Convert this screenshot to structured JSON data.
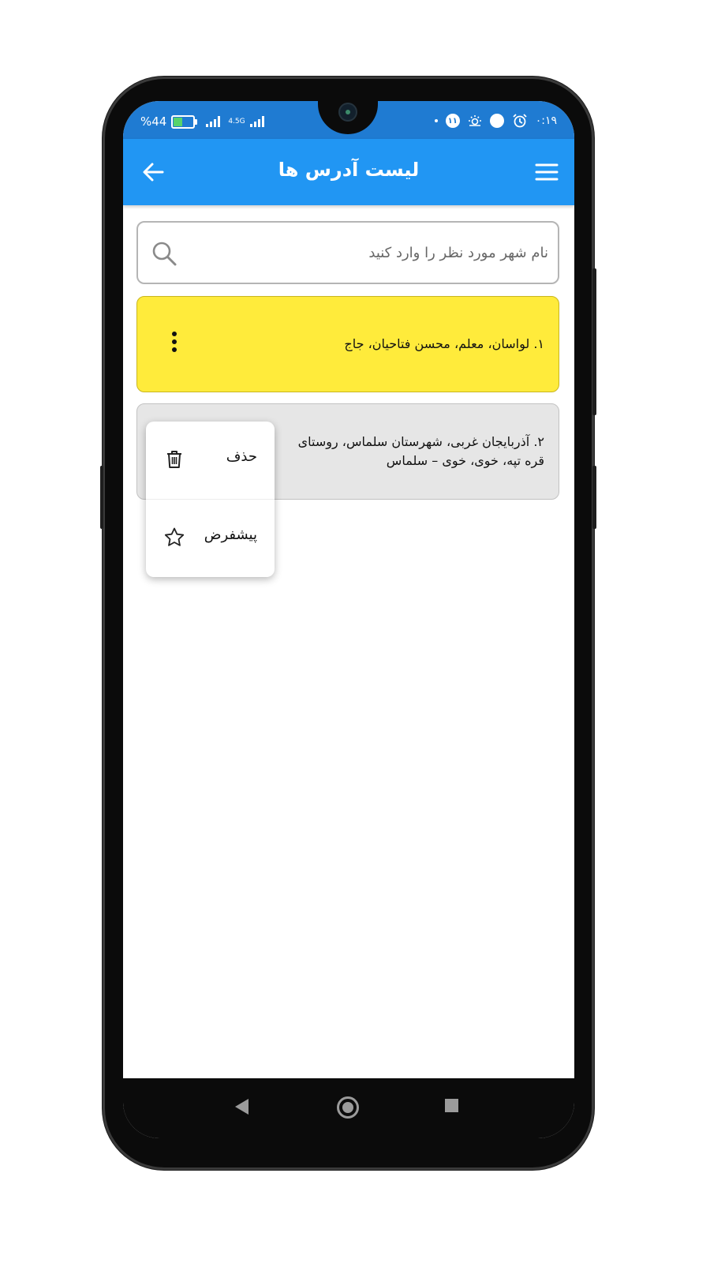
{
  "status_bar": {
    "battery_text": "%44",
    "network_type": "4.5G",
    "notification_count": "۱۱",
    "time": "۰:۱۹"
  },
  "app_bar": {
    "title": "لیست آدرس ها",
    "back_icon": "arrow-left-icon",
    "menu_icon": "hamburger-menu-icon"
  },
  "search": {
    "placeholder": "نام شهر مورد نظر را وارد کنید",
    "value": "",
    "icon": "search-icon"
  },
  "addresses": [
    {
      "number": "۱.",
      "text": "لواسان، معلم، محسن فتاحیان، جاج",
      "highlight_color": "#ffeb3b",
      "is_default": true
    },
    {
      "number": "۲.",
      "text": "آذربایجان غربی، شهرستان سلماس، روستای قره تپه، خوی، خوی – سلماس",
      "highlight_color": "#e6e6e6",
      "is_default": false
    }
  ],
  "context_menu": {
    "items": [
      {
        "label": "حذف",
        "icon": "trash-icon"
      },
      {
        "label": "پیشفرض",
        "icon": "star-outline-icon"
      }
    ]
  },
  "colors": {
    "app_bar": "#2196f3",
    "status_bar": "#1f7bd2"
  }
}
